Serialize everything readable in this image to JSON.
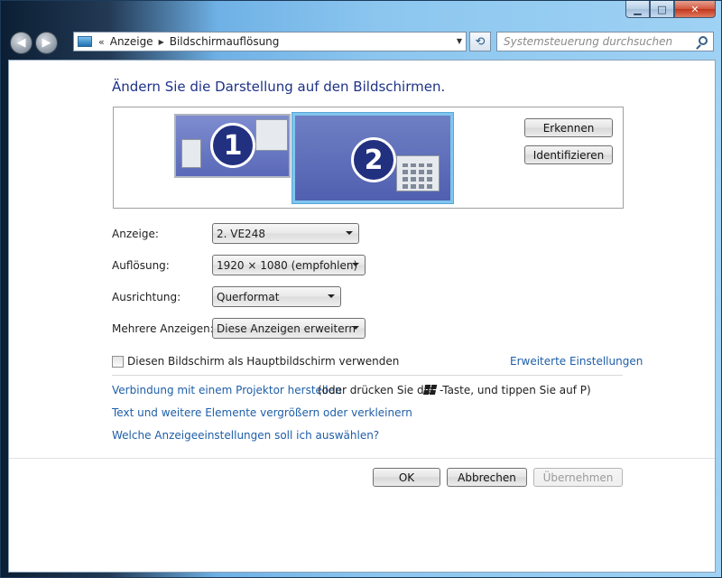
{
  "window": {
    "minimize_glyph": "▁",
    "maximize_glyph": "□",
    "close_glyph": "✕"
  },
  "nav": {
    "back_glyph": "◀",
    "forward_glyph": "▶",
    "history_glyph": "▼",
    "refresh_glyph": "⟲"
  },
  "address": {
    "overflow_glyph": "«",
    "crumbs": [
      "Anzeige",
      "Bildschirmauflösung"
    ],
    "separator_glyph": "▶",
    "dropdown_glyph": "▼"
  },
  "search": {
    "placeholder": "Systemsteuerung durchsuchen"
  },
  "page": {
    "title": "Ändern Sie die Darstellung auf den Bildschirmen."
  },
  "monitors": [
    {
      "number": "1",
      "selected": false
    },
    {
      "number": "2",
      "selected": true
    }
  ],
  "monitor_buttons": {
    "detect": "Erkennen",
    "identify": "Identifizieren"
  },
  "settings": {
    "display_label": "Anzeige:",
    "display_value": "2. VE248",
    "resolution_label": "Auflösung:",
    "resolution_value": "1920 × 1080 (empfohlen)",
    "orientation_label": "Ausrichtung:",
    "orientation_value": "Querformat",
    "multiple_label": "Mehrere Anzeigen:",
    "multiple_value": "Diese Anzeigen erweitern"
  },
  "primary_checkbox": {
    "label": "Diesen Bildschirm als Hauptbildschirm verwenden",
    "checked": false
  },
  "advanced_link": "Erweiterte Einstellungen",
  "links": {
    "projector": "Verbindung mit einem Projektor herstellen",
    "projector_hint_pre": "(oder drücken Sie die",
    "projector_hint_post": "-Taste, und tippen Sie auf P)",
    "text_size": "Text und weitere Elemente vergrößern oder verkleinern",
    "which_settings": "Welche Anzeigeeinstellungen soll ich auswählen?"
  },
  "actions": {
    "ok": "OK",
    "cancel": "Abbrechen",
    "apply": "Übernehmen"
  },
  "colors": {
    "title": "#1e3287",
    "link": "#1e5ea8",
    "monitor_fill": "#5a69b8",
    "monitor_selected_border": "#7fc5ee"
  }
}
